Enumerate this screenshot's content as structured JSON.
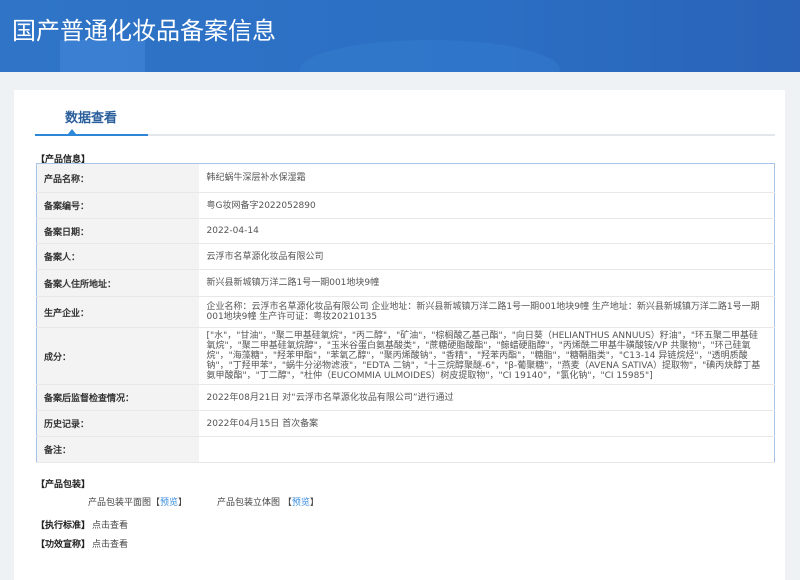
{
  "header": {
    "title": "国产普通化妆品备案信息"
  },
  "tab": {
    "label": "数据查看"
  },
  "product_info": {
    "section": "【产品信息】",
    "rows": [
      {
        "label": "产品名称：",
        "value": "韩纪蜗牛深层补水保湿霜"
      },
      {
        "label": "备案编号：",
        "value": "粤G妆网备字2022052890"
      },
      {
        "label": "备案日期：",
        "value": "2022-04-14"
      },
      {
        "label": "备案人：",
        "value": "云浮市名草源化妆品有限公司"
      },
      {
        "label": "备案人住所地址：",
        "value": "新兴县新城镇万洋二路1号一期001地块9幢"
      },
      {
        "label": "生产企业：",
        "value": "企业名称：云浮市名草源化妆品有限公司 企业地址：新兴县新城镇万洋二路1号一期001地块9幢 生产地址：新兴县新城镇万洋二路1号一期001地块9幢 生产许可证：粤妆20210135"
      },
      {
        "label": "成分：",
        "value": "[\"水\"，\"甘油\"，\"聚二甲基硅氧烷\"，\"丙二醇\"，\"矿油\"，\"棕榈酸乙基己酯\"，\"向日葵（HELIANTHUS ANNUUS）籽油\"，\"环五聚二甲基硅氧烷\"，\"聚二甲基硅氧烷醇\"，\"玉米谷蛋白氨基酸类\"，\"蔗糖硬脂酸酯\"，\"鲸蜡硬脂醇\"，\"丙烯酰二甲基牛磺酸铵/VP 共聚物\"，\"环己硅氧烷\"，\"海藻糖\"，\"羟苯甲酯\"，\"苯氧乙醇\"，\"聚丙烯酸钠\"，\"香精\"，\"羟苯丙酯\"，\"糖脂\"，\"糖鞘脂类\"，\"C13-14 异链烷烃\"，\"透明质酸钠\"，\"丁羟甲苯\"，\"蜗牛分泌物滤液\"，\"EDTA 二钠\"，\"十三烷醇聚醚-6\"，\"β-葡聚糖\"，\"燕麦（AVENA SATIVA）提取物\"，\"碘丙炔醇丁基氨甲酸酯\"，\"丁二醇\"，\"杜仲（EUCOMMIA ULMOIDES）树皮提取物\"，\"CI 19140\"，\"氯化钠\"，\"CI 15985\"]"
      },
      {
        "label": "备案后监督检查情况：",
        "value": "2022年08月21日 对“云浮市名草源化妆品有限公司”进行通过"
      },
      {
        "label": "历史记录：",
        "value": "2022年04月15日 首次备案"
      },
      {
        "label": "备注：",
        "value": ""
      }
    ]
  },
  "packaging": {
    "section": "【产品包装】",
    "flat_label": "产品包装平面图",
    "flat_link": "预览",
    "solid_label": "产品包装立体图",
    "solid_link": "预览",
    "bo": "【",
    "bc": "】"
  },
  "standard": {
    "section": "【执行标准】",
    "link": "点击查看"
  },
  "efficacy": {
    "section": "【功效宣称】",
    "link": "点击查看"
  }
}
